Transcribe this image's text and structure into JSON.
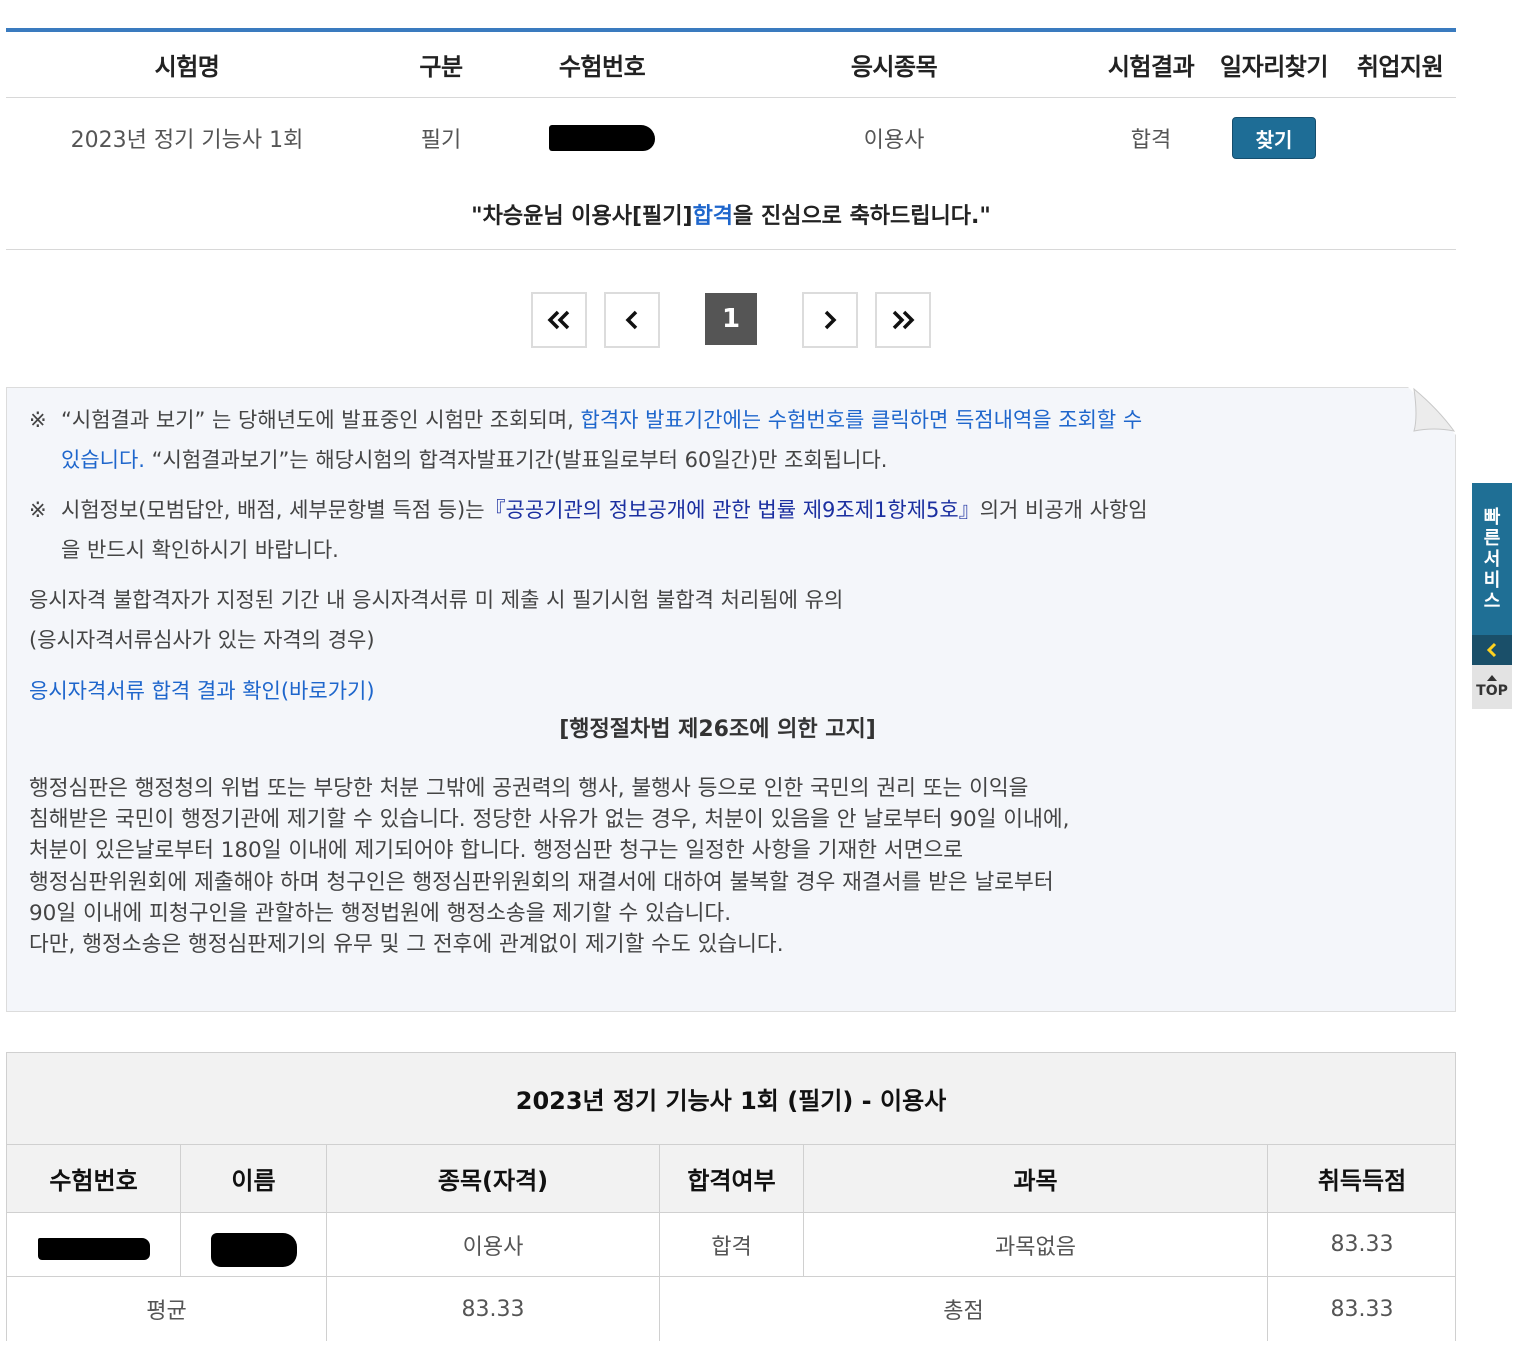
{
  "result_table": {
    "headers": [
      "시험명",
      "구분",
      "수험번호",
      "응시종목",
      "시험결과",
      "일자리찾기",
      "취업지원"
    ],
    "row": {
      "exam_name": "2023년 정기 기능사 1회",
      "category": "필기",
      "exam_number": "",
      "subject": "이용사",
      "result": "합격",
      "find_button": "찾기",
      "support": ""
    },
    "congrats": {
      "before": "\"차승윤님 이용사[필기] ",
      "highlight": "합격",
      "after": "을 진심으로 축하드립니다.\""
    },
    "colors": {
      "accent": "#3a7bbf",
      "button": "#1e6d96",
      "highlight": "#1e66cc"
    }
  },
  "pagination": {
    "first": "«",
    "prev": "‹",
    "current": "1",
    "next": "›",
    "last": "»"
  },
  "notice": {
    "mark": "※",
    "item1": {
      "plain1": "“시험결과 보기” 는 당해년도에 발표중인 시험만 조회되며, ",
      "link": "합격자 발표기간에는 수험번호를 클릭하면 득점내역을 조회할 수",
      "link2": "있습니다.",
      "plain2": " “시험결과보기”는 해당시험의 합격자발표기간(발표일로부터 60일간)만 조회됩니다."
    },
    "item2": {
      "plain1": "시험정보(모범답안, 배점, 세부문항별 득점 등)는",
      "law": "『공공기관의 정보공개에 관한 법률 제9조제1항제5호』",
      "plain2": "의거 비공개 사항임",
      "plain3": "을 반드시 확인하시기 바랍니다."
    },
    "text1": "응시자격 불합격자가 지정된 기간 내 응시자격서류 미 제출 시 필기시험 불합격 처리됨에 유의",
    "text2": "(응시자격서류심사가 있는 자격의 경우)",
    "link": "응시자격서류 합격 결과 확인(바로가기)",
    "notice_title": "[행정절차법 제26조에 의한 고지]",
    "para_lines": [
      "행정심판은 행정청의 위법 또는 부당한 처분 그밖에 공권력의 행사, 불행사 등으로 인한 국민의 권리 또는 이익을",
      "침해받은 국민이 행정기관에 제기할 수 있습니다. 정당한 사유가 없는 경우, 처분이 있음을 안 날로부터 90일 이내에,",
      "처분이 있은날로부터 180일 이내에 제기되어야 합니다. 행정심판 청구는 일정한 사항을 기재한 서면으로",
      "행정심판위원회에 제출해야 하며 청구인은 행정심판위원회의 재결서에 대하여 불복할 경우 재결서를 받은 날로부터",
      "90일 이내에 피청구인을 관할하는 행정법원에 행정소송을 제기할 수 있습니다.",
      "다만, 행정소송은 행정심판제기의 유무 및 그 전후에 관계없이 제기할 수도 있습니다."
    ]
  },
  "score_table": {
    "title": "2023년 정기 기능사 1회 (필기) - 이용사",
    "headers": [
      "수험번호",
      "이름",
      "종목(자격)",
      "합격여부",
      "과목",
      "취득득점"
    ],
    "row": {
      "exam_number": "",
      "name": "",
      "subject": "이용사",
      "pass": "합격",
      "course": "과목없음",
      "score": "83.33"
    },
    "summary": {
      "avg_label": "평균",
      "avg_value": "83.33",
      "total_label": "총점",
      "total_value": "83.33"
    }
  },
  "quick_service": {
    "label_chars": [
      "빠",
      "른",
      "서",
      "비",
      "스"
    ],
    "collapse": "<",
    "top": "TOP"
  }
}
